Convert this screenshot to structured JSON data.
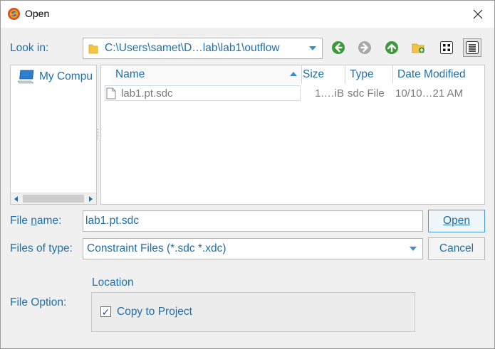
{
  "window": {
    "title": "Open",
    "close_symbol": "✕"
  },
  "look_in": {
    "label": "Look in:",
    "path": "C:\\Users\\samet\\D…lab\\lab1\\outflow"
  },
  "toolbar": {
    "icons": [
      "back-icon",
      "forward-icon",
      "up-folder-icon",
      "new-folder-icon",
      "list-view-icon",
      "detail-view-icon"
    ]
  },
  "sidebar": {
    "items": [
      {
        "label": "My Compu",
        "icon": "computer-icon"
      }
    ]
  },
  "file_list": {
    "columns": [
      "Name",
      "Size",
      "Type",
      "Date Modified"
    ],
    "rows": [
      {
        "name": "lab1.pt.sdc",
        "size": "1.…iB",
        "type": "sdc File",
        "date": "10/10…21 AM"
      }
    ]
  },
  "file_name": {
    "label_before": "File ",
    "label_accel": "n",
    "label_after": "ame:",
    "value": "lab1.pt.sdc"
  },
  "file_type": {
    "label": "Files of type:",
    "value": "Constraint Files (*.sdc *.xdc)"
  },
  "buttons": {
    "open": "Open",
    "cancel": "Cancel"
  },
  "file_option": {
    "label": "File Option:",
    "group_title": "Location",
    "checkbox_label": "Copy to Project",
    "checked": true,
    "check_mark": "✓"
  },
  "colors": {
    "accent_text": "#1f6fa8",
    "nav_green": "#3a9a3a",
    "arrow_blue": "#3a8fd0"
  }
}
